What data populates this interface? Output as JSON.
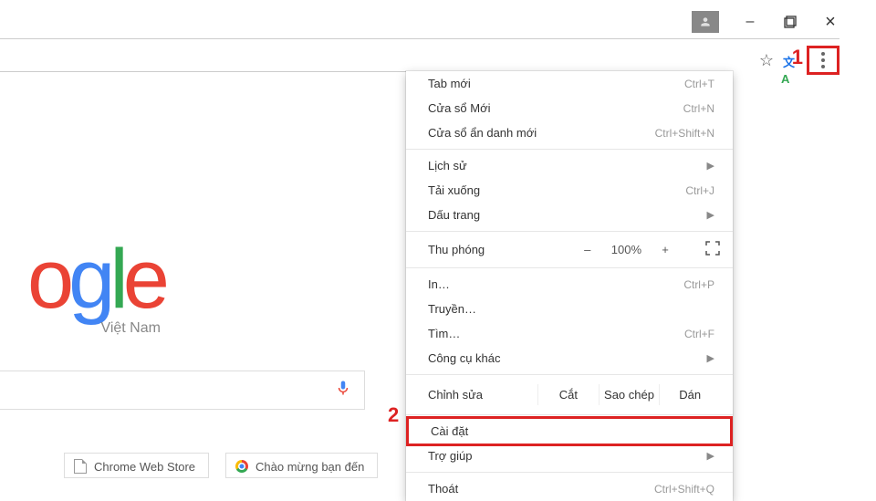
{
  "annotations": {
    "one": "1",
    "two": "2"
  },
  "titlebar": {
    "minimize": "–",
    "close": "×"
  },
  "bookmark": {
    "item1": "Chrome Web Store",
    "item2": "Chào mừng bạn đến"
  },
  "logo": {
    "sub": "Việt Nam"
  },
  "menu": {
    "new_tab": {
      "label": "Tab mới",
      "sc": "Ctrl+T"
    },
    "new_window": {
      "label": "Cửa sổ Mới",
      "sc": "Ctrl+N"
    },
    "incognito": {
      "label": "Cửa sổ ẩn danh mới",
      "sc": "Ctrl+Shift+N"
    },
    "history": {
      "label": "Lịch sử"
    },
    "downloads": {
      "label": "Tải xuống",
      "sc": "Ctrl+J"
    },
    "bookmarks": {
      "label": "Dấu trang"
    },
    "zoom": {
      "label": "Thu phóng",
      "minus": "–",
      "value": "100%",
      "plus": "+"
    },
    "print": {
      "label": "In…",
      "sc": "Ctrl+P"
    },
    "cast": {
      "label": "Truyền…"
    },
    "find": {
      "label": "Tìm…",
      "sc": "Ctrl+F"
    },
    "tools": {
      "label": "Công cụ khác"
    },
    "edit": {
      "label": "Chỉnh sửa",
      "cut": "Cắt",
      "copy": "Sao chép",
      "paste": "Dán"
    },
    "settings": {
      "label": "Cài đặt"
    },
    "help": {
      "label": "Trợ giúp"
    },
    "exit": {
      "label": "Thoát",
      "sc": "Ctrl+Shift+Q"
    }
  }
}
